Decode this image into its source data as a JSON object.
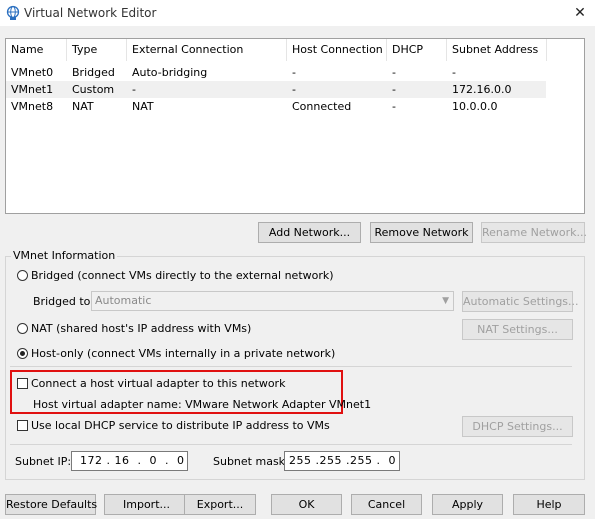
{
  "window": {
    "title": "Virtual Network Editor",
    "close_glyph": "✕",
    "icon": "network-globe-icon"
  },
  "list": {
    "columns": [
      "Name",
      "Type",
      "External Connection",
      "Host Connection",
      "DHCP",
      "Subnet Address"
    ],
    "rows": [
      {
        "name": "VMnet0",
        "type": "Bridged",
        "external": "Auto-bridging",
        "host": "-",
        "dhcp": "-",
        "subnet": "-"
      },
      {
        "name": "VMnet1",
        "type": "Custom",
        "external": "-",
        "host": "-",
        "dhcp": "-",
        "subnet": "172.16.0.0"
      },
      {
        "name": "VMnet8",
        "type": "NAT",
        "external": "NAT",
        "host": "Connected",
        "dhcp": "-",
        "subnet": "10.0.0.0"
      }
    ],
    "selected_row": 1
  },
  "list_buttons": {
    "add": "Add Network...",
    "remove": "Remove Network",
    "rename": "Rename Network..."
  },
  "vmnet_info": {
    "group_label": "VMnet Information",
    "bridged_label": "Bridged (connect VMs directly to the external network)",
    "bridged_to_label": "Bridged to:",
    "bridged_to_value": "Automatic",
    "auto_settings": "Automatic Settings...",
    "nat_label": "NAT (shared host's IP address with VMs)",
    "nat_settings": "NAT Settings...",
    "hostonly_label": "Host-only (connect VMs internally in a private network)",
    "selected_mode": "host-only",
    "connect_adapter_label": "Connect a host virtual adapter to this network",
    "connect_adapter_checked": false,
    "adapter_name_label": "Host virtual adapter name: VMware Network Adapter VMnet1",
    "dhcp_label": "Use local DHCP service to distribute IP address to VMs",
    "dhcp_checked": false,
    "dhcp_settings": "DHCP Settings...",
    "subnet_ip_label": "Subnet IP:",
    "subnet_ip_value": " 172 . 16  .  0  .  0",
    "subnet_mask_label": "Subnet mask:",
    "subnet_mask_value": "255 .255 .255 .  0"
  },
  "bottom_buttons": {
    "restore": "Restore Defaults",
    "import": "Import...",
    "export": "Export...",
    "ok": "OK",
    "cancel": "Cancel",
    "apply": "Apply",
    "help": "Help"
  },
  "colors": {
    "highlight_box": "#e01010",
    "dialog_bg": "#f0f0f0"
  }
}
